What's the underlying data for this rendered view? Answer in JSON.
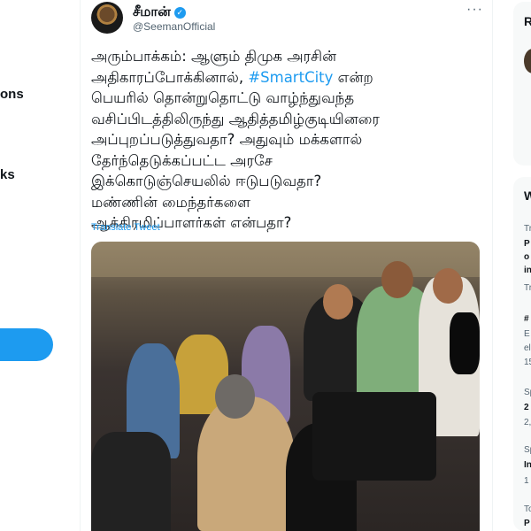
{
  "left_nav": {
    "items": [
      {
        "label": "ons"
      },
      {
        "label": "ks"
      }
    ]
  },
  "tweet": {
    "display_name": "சீமான்",
    "handle": "@SeemanOfficial",
    "text_lines": [
      "அரும்பாக்கம்: ஆளும் திமுக அரசின்",
      "அதிகாரப்போக்கினால், ",
      "பெயரில் தொன்றுதொட்டு வாழ்ந்துவந்த",
      "வசிப்பிடத்திலிருந்து ஆதித்தமிழ்குடியினரை",
      "அப்புறப்படுத்துவதா? அதுவும் மக்களால்",
      "தேர்ந்தெடுக்கப்பட்ட அரசே",
      "இக்கொடுஞ்செயலில் ஈடுபடுவதா?",
      "மண்ணின் மைந்தர்களை",
      "ஆக்கிரமிப்பாளர்கள் என்பதா?"
    ],
    "hashtag": "#SmartCity",
    "after_hashtag": " என்ற",
    "translate_label": "Translate Tweet",
    "more_label": "···"
  },
  "right_sidebar": {
    "lines": [
      {
        "text": "R",
        "bold": true
      },
      {
        "text": "W",
        "bold": true
      },
      {
        "text": "Tr",
        "bold": false
      },
      {
        "text": "P",
        "bold": true
      },
      {
        "text": "o",
        "bold": true
      },
      {
        "text": "in",
        "bold": true
      },
      {
        "text": "Tr",
        "bold": false
      },
      {
        "text": "#",
        "bold": true
      },
      {
        "text": "E",
        "bold": false
      },
      {
        "text": "el",
        "bold": false
      },
      {
        "text": "15",
        "bold": false
      },
      {
        "text": "Sp",
        "bold": false
      },
      {
        "text": "2",
        "bold": true
      },
      {
        "text": "2,",
        "bold": false
      },
      {
        "text": "Sp",
        "bold": false
      },
      {
        "text": "In",
        "bold": true
      },
      {
        "text": "1",
        "bold": false
      },
      {
        "text": "To",
        "bold": false
      },
      {
        "text": "P",
        "bold": true
      }
    ]
  },
  "colors": {
    "accent": "#1d9bf0",
    "text": "#0f1419",
    "muted": "#536471"
  }
}
